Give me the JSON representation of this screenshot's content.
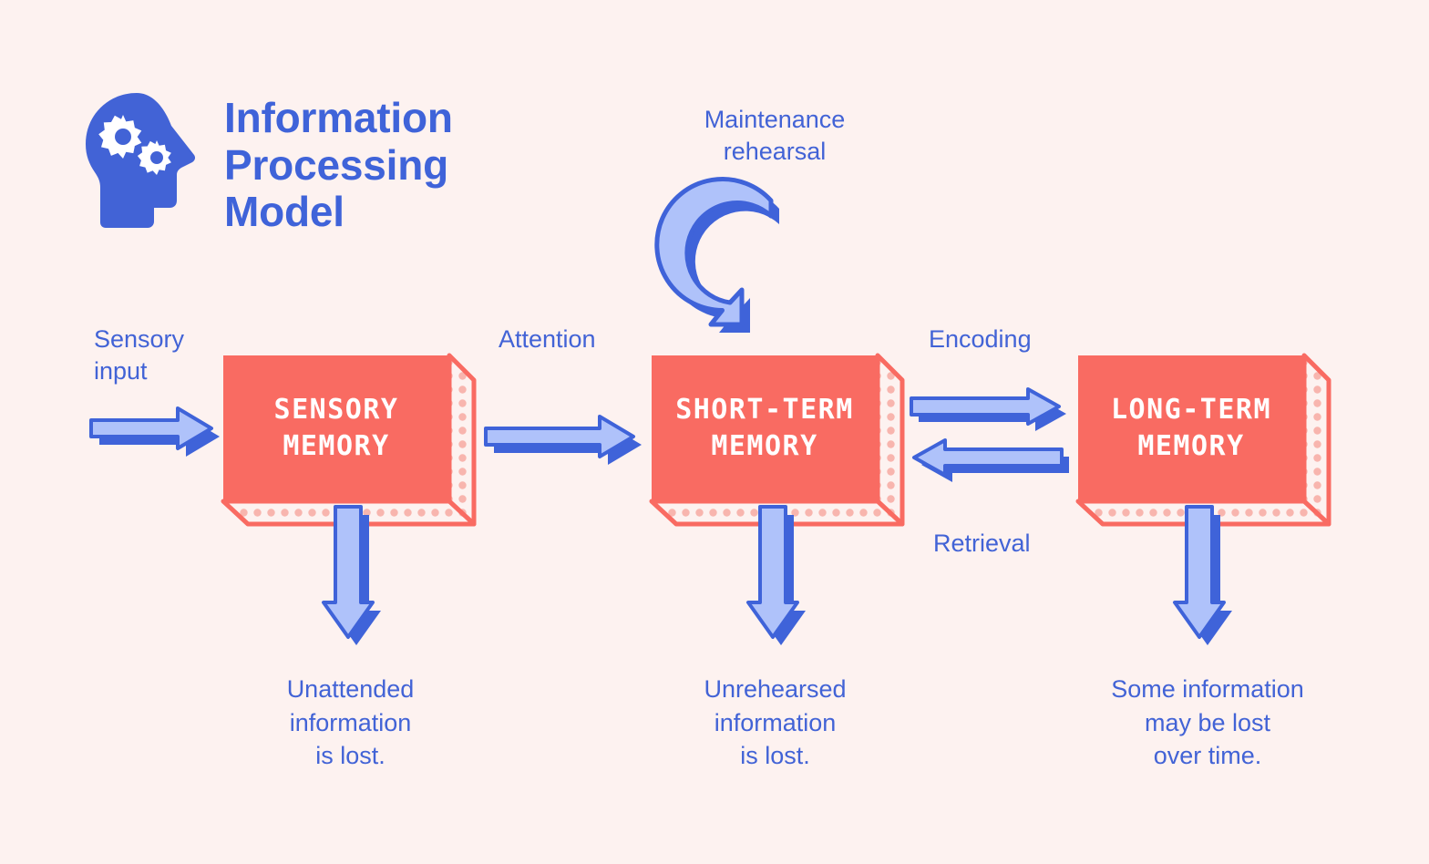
{
  "background_color": "#FDF2F0",
  "palette": {
    "blue": "#4263D6",
    "blue_dark": "#3F63D9",
    "arrow_fill": "#AFC2FA",
    "box_fill": "#F96B62",
    "box_side_dot": "#F8B5AE",
    "box_side_fill": "#FDF2F0",
    "white": "#FFFFFF"
  },
  "header": {
    "icon": "head-with-gears-icon",
    "title": "Information\nProcessing\nModel"
  },
  "labels": {
    "sensory_input": "Sensory\ninput",
    "attention": "Attention",
    "maintenance_rehearsal": "Maintenance\nrehearsal",
    "encoding": "Encoding",
    "retrieval": "Retrieval"
  },
  "boxes": [
    {
      "id": "sensory-memory",
      "title": "SENSORY\nMEMORY"
    },
    {
      "id": "short-term-memory",
      "title": "SHORT-TERM\nMEMORY"
    },
    {
      "id": "long-term-memory",
      "title": "LONG-TERM\nMEMORY"
    }
  ],
  "captions": [
    {
      "id": "unattended",
      "text": "Unattended\ninformation\nis lost."
    },
    {
      "id": "unrehearsed",
      "text": "Unrehearsed\ninformation\nis lost."
    },
    {
      "id": "decay",
      "text": "Some information\nmay be lost\nover time."
    }
  ],
  "arrows": {
    "sensory_input_arrow": "arrow-right-icon",
    "attention_arrow": "arrow-right-icon",
    "encoding_arrow": "arrow-right-icon",
    "retrieval_arrow": "arrow-left-icon",
    "rehearsal_loop": "circular-arrow-icon",
    "loss_arrow_1": "arrow-down-icon",
    "loss_arrow_2": "arrow-down-icon",
    "loss_arrow_3": "arrow-down-icon"
  }
}
